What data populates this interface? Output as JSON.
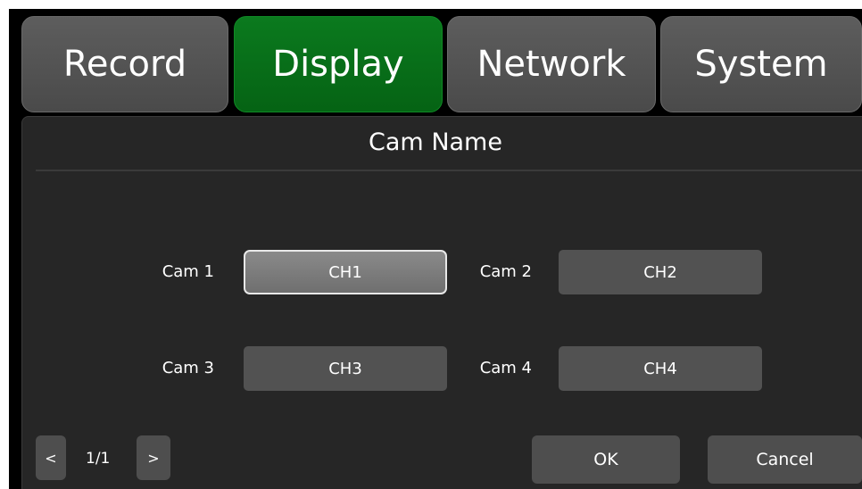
{
  "tabs": [
    {
      "label": "Record",
      "active": false
    },
    {
      "label": "Display",
      "active": true
    },
    {
      "label": "Network",
      "active": false
    },
    {
      "label": "System",
      "active": false
    }
  ],
  "panel": {
    "title": "Cam Name"
  },
  "cameras": [
    {
      "label": "Cam 1",
      "value": "CH1",
      "selected": true
    },
    {
      "label": "Cam 2",
      "value": "CH2",
      "selected": false
    },
    {
      "label": "Cam 3",
      "value": "CH3",
      "selected": false
    },
    {
      "label": "Cam 4",
      "value": "CH4",
      "selected": false
    }
  ],
  "pagination": {
    "prev": "<",
    "indicator": "1/1",
    "next": ">"
  },
  "actions": {
    "ok": "OK",
    "cancel": "Cancel"
  },
  "colors": {
    "active_tab": "#056314",
    "inactive_tab": "#4a4a4a",
    "panel_bg": "#262626",
    "field_bg": "#525252"
  }
}
